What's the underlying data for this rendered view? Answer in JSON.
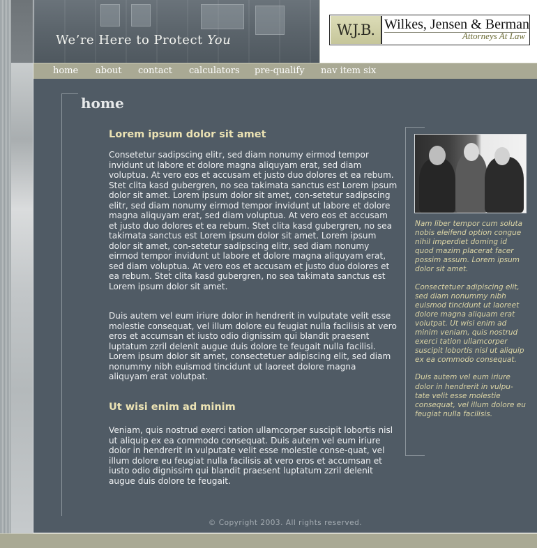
{
  "header": {
    "tagline_prefix": "We’re Here to Protect ",
    "tagline_emphasis": "You",
    "logo_monogram": "W.J.B.",
    "logo_name": "Wilkes, Jensen & Berman",
    "logo_subtitle": "Attorneys At Law"
  },
  "nav": {
    "items": [
      {
        "label": "home"
      },
      {
        "label": "about"
      },
      {
        "label": "contact"
      },
      {
        "label": "calculators"
      },
      {
        "label": "pre-qualify"
      },
      {
        "label": "nav item six"
      }
    ]
  },
  "main": {
    "page_title": "home",
    "sections": [
      {
        "heading": "Lorem ipsum dolor sit amet",
        "paragraphs": [
          "Consetetur sadipscing elitr, sed diam nonumy eirmod tempor invidunt ut labore et dolore magna aliquyam erat, sed diam voluptua. At vero eos et accusam et justo duo dolores et ea rebum. Stet clita kasd gubergren, no sea takimata sanctus est Lorem ipsum dolor sit amet. Lorem ipsum dolor sit amet, con-setetur sadipscing elitr, sed diam nonumy eirmod tempor invidunt ut labore et dolore magna aliquyam erat, sed diam voluptua. At vero eos et accusam et justo duo dolores et ea rebum. Stet clita kasd gubergren, no sea takimata sanctus est Lorem ipsum dolor sit amet. Lorem ipsum dolor sit amet, con-setetur sadipscing elitr, sed diam nonumy eirmod tempor invidunt ut labore et dolore magna aliquyam erat, sed diam voluptua. At vero eos et accusam et justo duo dolores et ea rebum. Stet clita kasd gubergren, no sea takimata sanctus est Lorem ipsum dolor sit amet.",
          "Duis autem vel eum iriure dolor in hendrerit in vulputate velit esse molestie consequat, vel illum dolore eu feugiat nulla facilisis at vero eros et accumsan et iusto odio dignissim qui blandit praesent luptatum zzril delenit augue duis dolore te feugait nulla facilisi. Lorem ipsum dolor sit amet, consectetuer adipiscing elit, sed diam nonummy nibh euismod tincidunt ut laoreet dolore magna aliquyam erat volutpat."
        ]
      },
      {
        "heading": "Ut wisi enim ad minim",
        "paragraphs": [
          "Veniam, quis nostrud exerci tation ullamcorper suscipit lobortis nisl ut aliquip ex ea commodo consequat. Duis autem vel eum iriure dolor in hendrerit in vulputate velit esse molestie conse-quat, vel illum dolore eu feugiat nulla facilisis at vero eros et accumsan et iusto odio dignissim qui blandit praesent luptatum zzril delenit augue duis dolore te feugait."
        ]
      }
    ]
  },
  "sidebar": {
    "paragraphs": [
      "Nam liber tempor cum soluta nobis eleifend option congue nihil imperdiet doming id quod mazim placerat facer possim assum. Lorem ipsum dolor sit amet.",
      "Consectetuer adipiscing elit, sed diam nonummy nibh euismod tincidunt ut laoreet dolore magna aliquam erat volutpat. Ut wisi enim ad minim veniam, quis nostrud exerci tation ullamcorper suscipit lobortis nisl ut aliquip ex ea commodo consequat.",
      "Duis autem vel eum iriure dolor in hendrerit in vulpu-tate velit esse molestie consequat, vel illum dolore eu feugiat nulla facilisis."
    ]
  },
  "footer": {
    "copyright": "© Copyright 2003. All rights reserved."
  },
  "colors": {
    "main_background": "#505b65",
    "nav_background": "#a9a994",
    "heading": "#ece3b4",
    "sidebar_text": "#ddd6a6"
  }
}
